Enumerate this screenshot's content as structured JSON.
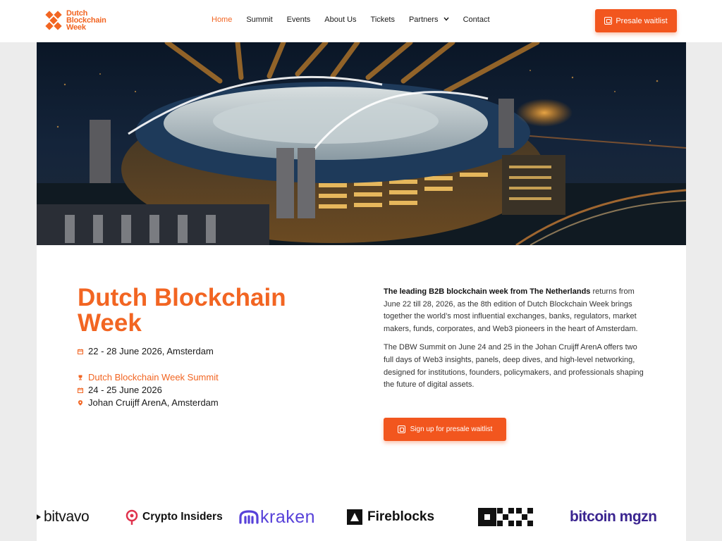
{
  "brand": {
    "name_line1": "Dutch",
    "name_line2": "Blockchain",
    "name_line3": "Week",
    "accent": "#f26522"
  },
  "nav": {
    "items": [
      {
        "label": "Home",
        "active": true
      },
      {
        "label": "Summit"
      },
      {
        "label": "Events"
      },
      {
        "label": "About Us"
      },
      {
        "label": "Tickets"
      },
      {
        "label": "Partners"
      },
      {
        "label": "Contact"
      }
    ],
    "presale_label": "Presale waitlist"
  },
  "hero": {
    "image": "stadium-aerial-night-photo"
  },
  "event": {
    "title": "Dutch Blockchain Week",
    "dates": "22 - 28 June 2026, Amsterdam",
    "summit_name": "Dutch Blockchain Week Summit",
    "summit_dates": "24 - 25 June 2026",
    "summit_location": "Johan Cruijff ArenA, Amsterdam"
  },
  "description": {
    "p1_bold": "The leading B2B blockchain week from The Netherlands",
    "p1_rest": " returns from June 22 till 28, 2026, as the 8th edition of Dutch Blockchain Week brings together the world’s most influential exchanges, banks, regulators, market makers, funds, corporates, and Web3 pioneers in the heart of Amsterdam.",
    "p2": "The DBW Summit on June 24 and 25 in the Johan Cruijff ArenA offers two full days of Web3 insights, panels, deep dives, and high-level networking, designed for institutions, founders, policymakers, and professionals shaping the future of digital assets.",
    "cta_label": "Sign up for presale waitlist"
  },
  "partners": [
    {
      "name": "bitvavo",
      "label": "bitvavo"
    },
    {
      "name": "crypto-insiders",
      "label": "Crypto Insiders"
    },
    {
      "name": "kraken",
      "label": "kraken"
    },
    {
      "name": "fireblocks",
      "label": "Fireblocks"
    },
    {
      "name": "okx",
      "label": "OKX"
    },
    {
      "name": "bitcoin-magazine",
      "label": "bitcoin mgzn"
    }
  ]
}
